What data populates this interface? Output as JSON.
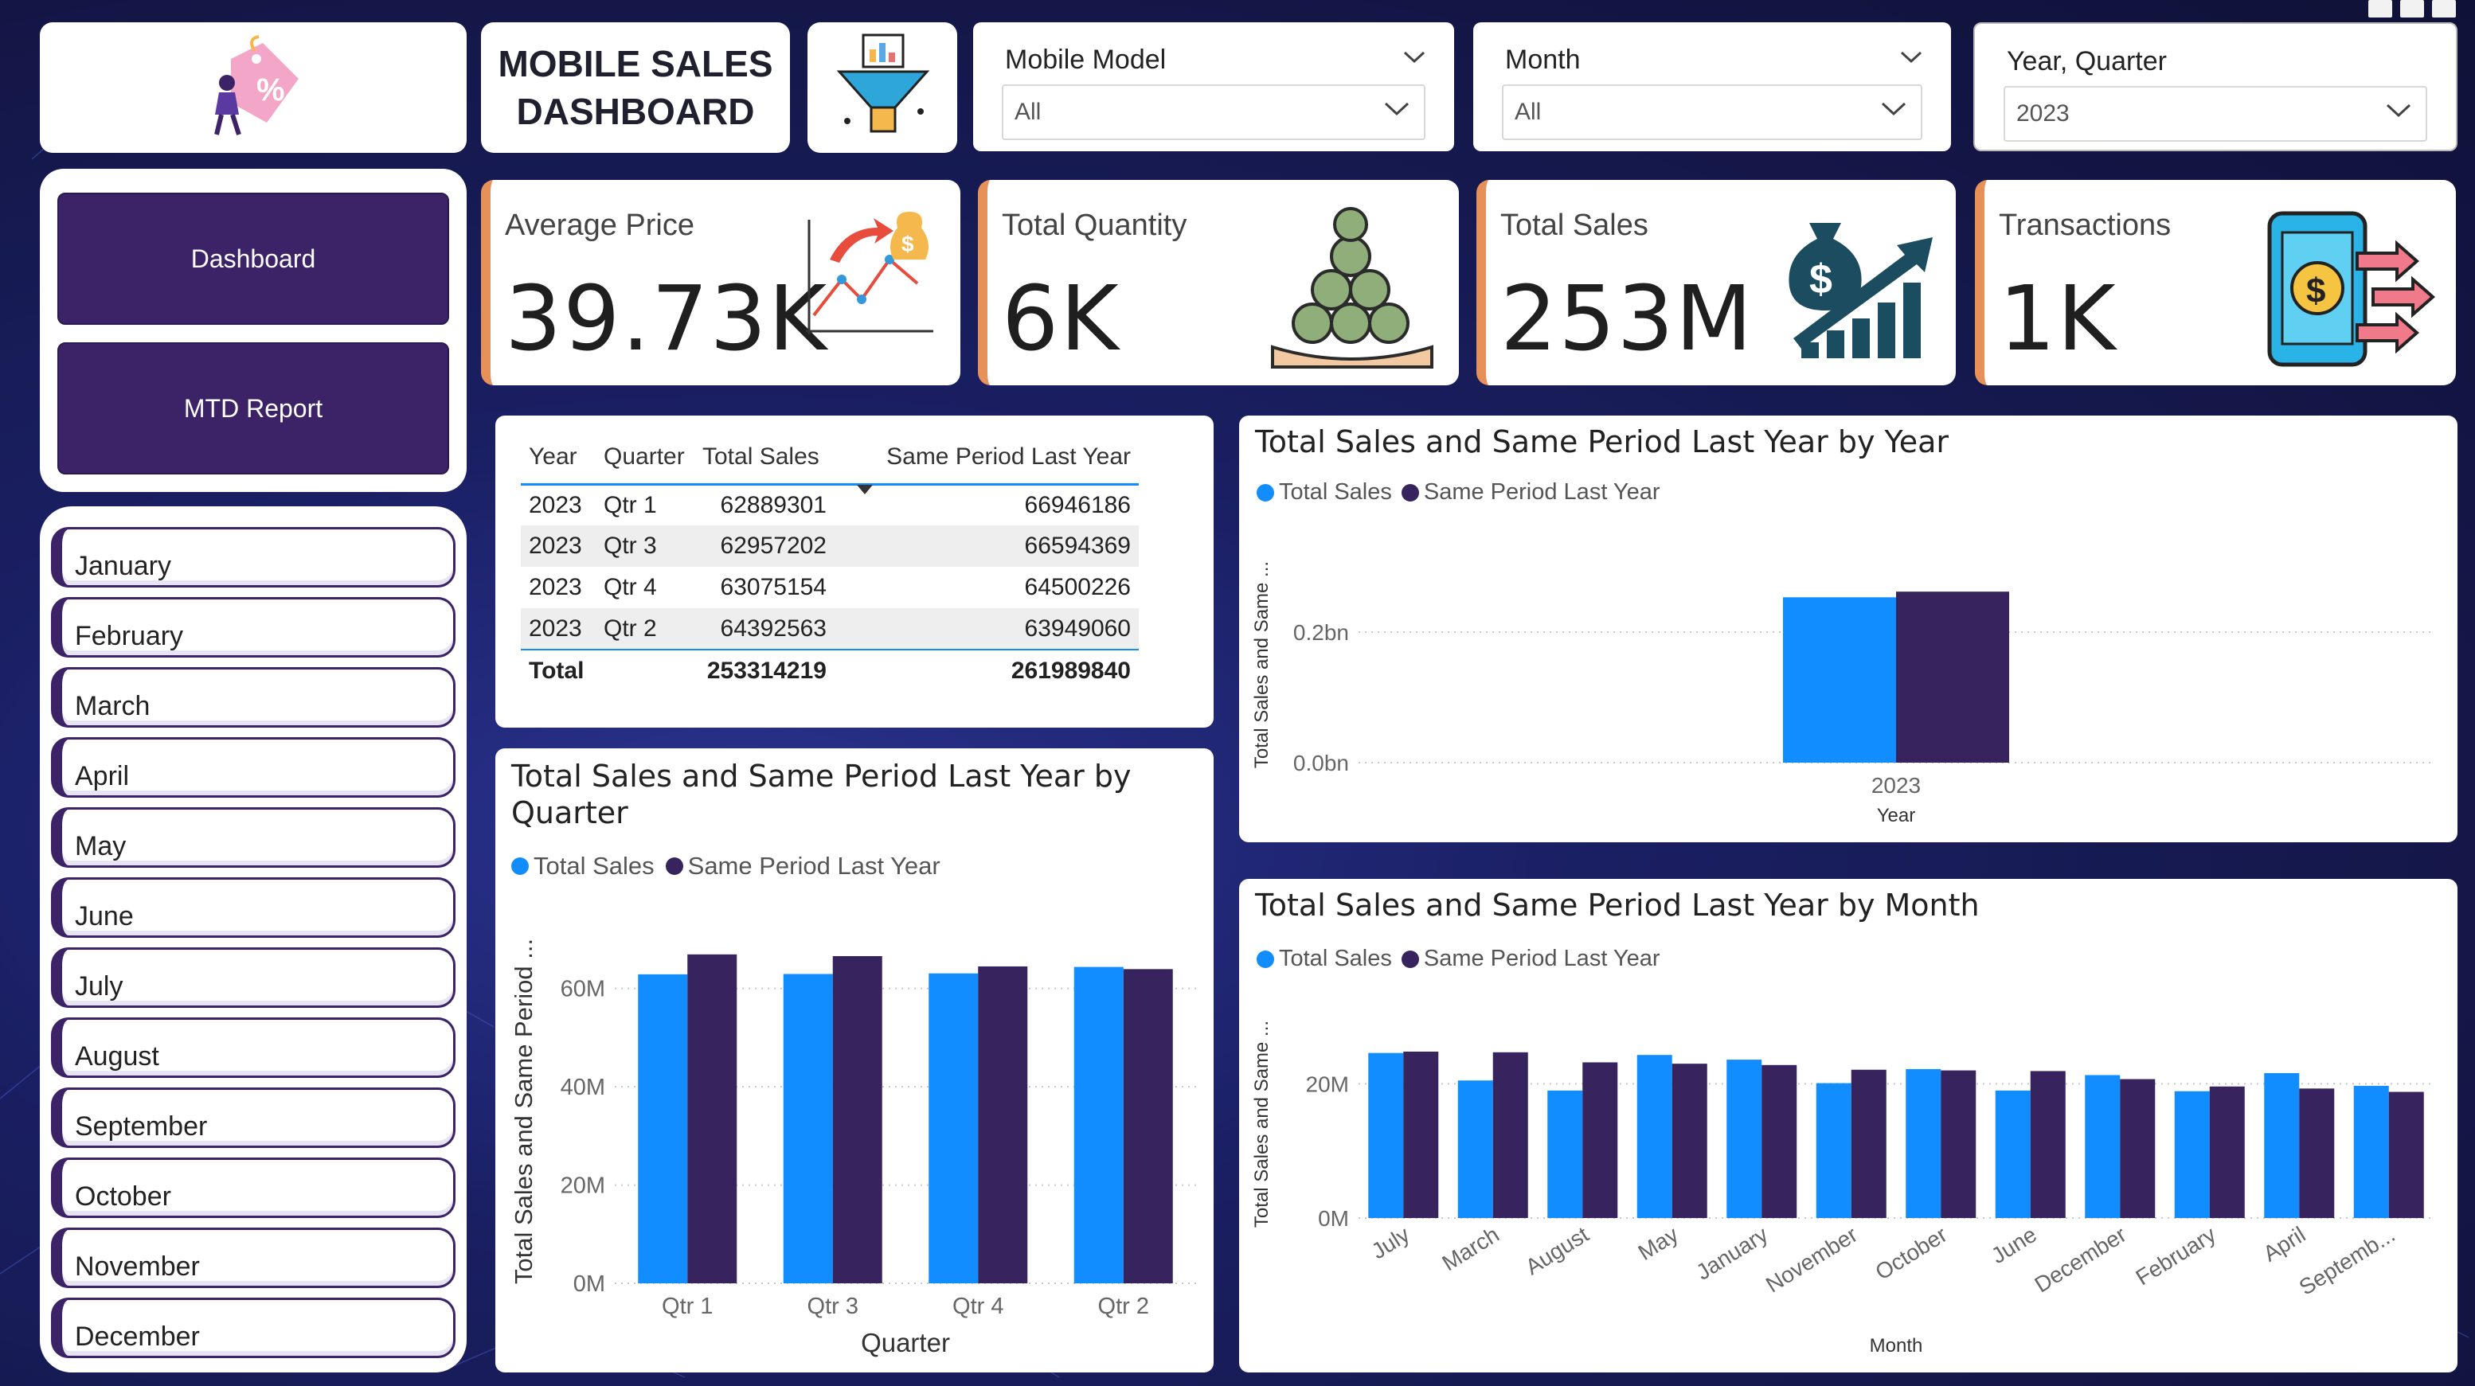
{
  "header": {
    "title_line1": "MOBILE SALES",
    "title_line2": "DASHBOARD",
    "logo_icon": "discount-tag-icon",
    "filter_icon": "funnel-chart-icon"
  },
  "slicers": {
    "model": {
      "label": "Mobile Model",
      "value": "All"
    },
    "month": {
      "label": "Month",
      "value": "All"
    },
    "year_quarter": {
      "label": "Year, Quarter",
      "value": "2023"
    }
  },
  "nav": {
    "dashboard": "Dashboard",
    "mtd": "MTD Report"
  },
  "months": [
    "January",
    "February",
    "March",
    "April",
    "May",
    "June",
    "July",
    "August",
    "September",
    "October",
    "November",
    "December"
  ],
  "kpis": [
    {
      "label": "Average Price",
      "value": "39.73K",
      "icon": "price-trend-icon"
    },
    {
      "label": "Total Quantity",
      "value": "6K",
      "icon": "coins-hand-icon"
    },
    {
      "label": "Total Sales",
      "value": "253M",
      "icon": "money-growth-icon"
    },
    {
      "label": "Transactions",
      "value": "1K",
      "icon": "mobile-payment-icon"
    }
  ],
  "table": {
    "headers": [
      "Year",
      "Quarter",
      "Total Sales",
      "Same Period Last Year"
    ],
    "rows": [
      [
        "2023",
        "Qtr 1",
        "62889301",
        "66946186"
      ],
      [
        "2023",
        "Qtr 3",
        "62957202",
        "66594369"
      ],
      [
        "2023",
        "Qtr 4",
        "63075154",
        "64500226"
      ],
      [
        "2023",
        "Qtr 2",
        "64392563",
        "63949060"
      ]
    ],
    "total": [
      "Total",
      "253314219",
      "261989840"
    ]
  },
  "colors": {
    "total_sales": "#118dff",
    "same_period": "#37245e",
    "accent": "#e7915a",
    "nav": "#3c2367"
  },
  "chart_data": [
    {
      "type": "bar",
      "title": "Total Sales and Same Period Last Year by Year",
      "xlabel": "Year",
      "ylabel": "Total Sales and Same ...",
      "categories": [
        "2023"
      ],
      "series": [
        {
          "name": "Total Sales",
          "values": [
            253314219
          ]
        },
        {
          "name": "Same Period Last Year",
          "values": [
            261989840
          ]
        }
      ],
      "yticks": [
        "0.0bn",
        "0.2bn"
      ],
      "ytick_values": [
        0,
        200000000
      ],
      "ylim": [
        0,
        300000000
      ],
      "grid": true,
      "legend": "top-left"
    },
    {
      "type": "bar",
      "title": "Total Sales and Same Period Last Year by Quarter",
      "xlabel": "Quarter",
      "ylabel": "Total Sales and Same Period ...",
      "categories": [
        "Qtr 1",
        "Qtr 3",
        "Qtr 4",
        "Qtr 2"
      ],
      "series": [
        {
          "name": "Total Sales",
          "values": [
            62889301,
            62957202,
            63075154,
            64392563
          ]
        },
        {
          "name": "Same Period Last Year",
          "values": [
            66946186,
            66594369,
            64500226,
            63949060
          ]
        }
      ],
      "yticks": [
        "0M",
        "20M",
        "40M",
        "60M"
      ],
      "ytick_values": [
        0,
        20000000,
        40000000,
        60000000
      ],
      "ylim": [
        0,
        70000000
      ],
      "grid": true,
      "legend": "top-left"
    },
    {
      "type": "bar",
      "title": "Total Sales and Same Period Last Year by Month",
      "xlabel": "Month",
      "ylabel": "Total Sales and Same ...",
      "categories": [
        "July",
        "March",
        "August",
        "May",
        "January",
        "November",
        "October",
        "June",
        "December",
        "February",
        "April",
        "Septemb..."
      ],
      "series": [
        {
          "name": "Total Sales",
          "values": [
            24.6,
            20.5,
            19.0,
            24.3,
            23.6,
            20.1,
            22.2,
            19.0,
            21.3,
            18.9,
            21.6,
            19.7
          ]
        },
        {
          "name": "Same Period Last Year",
          "values": [
            24.8,
            24.7,
            23.2,
            23.0,
            22.8,
            22.1,
            22.0,
            21.9,
            20.7,
            19.6,
            19.3,
            18.8
          ]
        }
      ],
      "value_unit": "M",
      "yticks": [
        "0M",
        "20M"
      ],
      "ytick_values": [
        0,
        20
      ],
      "ylim": [
        0,
        28
      ],
      "grid": true,
      "legend": "top-left"
    }
  ]
}
